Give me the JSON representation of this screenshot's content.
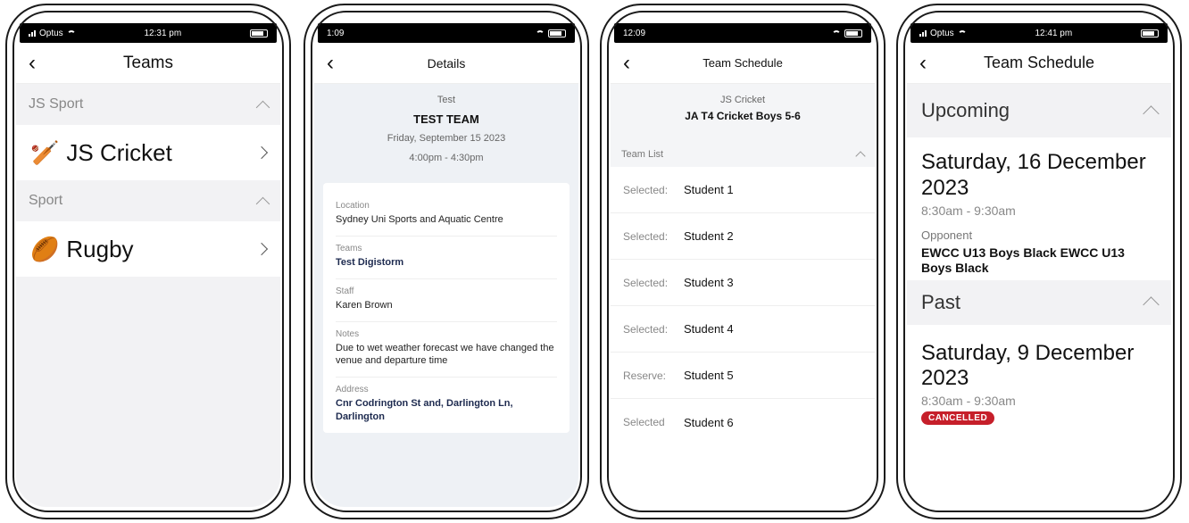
{
  "phone1": {
    "status": {
      "carrier": "Optus",
      "time": "12:31 pm"
    },
    "title": "Teams",
    "sections": [
      {
        "name": "JS Sport",
        "item": "JS Cricket"
      },
      {
        "name": "Sport",
        "item": "Rugby"
      }
    ]
  },
  "phone2": {
    "status": {
      "time": "1:09"
    },
    "title": "Details",
    "header": {
      "subtitle": "Test",
      "team": "TEST TEAM",
      "date": "Friday, September 15 2023",
      "time": "4:00pm - 4:30pm"
    },
    "fields": {
      "location_label": "Location",
      "location": "Sydney Uni Sports and Aquatic Centre",
      "teams_label": "Teams",
      "teams": "Test Digistorm",
      "staff_label": "Staff",
      "staff": "Karen Brown",
      "notes_label": "Notes",
      "notes": "Due to wet weather forecast we have changed the venue and departure time",
      "address_label": "Address",
      "address": "Cnr Codrington St and, Darlington Ln, Darlington"
    }
  },
  "phone3": {
    "status": {
      "time": "12:09"
    },
    "title": "Team Schedule",
    "header": {
      "subtitle": "JS Cricket",
      "team": "JA T4 Cricket Boys 5-6"
    },
    "list_label": "Team List",
    "students": [
      {
        "status": "Selected:",
        "name": "Student 1"
      },
      {
        "status": "Selected:",
        "name": "Student 2"
      },
      {
        "status": "Selected:",
        "name": "Student 3"
      },
      {
        "status": "Selected:",
        "name": "Student 4"
      },
      {
        "status": "Reserve:",
        "name": "Student 5"
      },
      {
        "status": "Selected",
        "name": "Student 6"
      }
    ]
  },
  "phone4": {
    "status": {
      "carrier": "Optus",
      "time": "12:41 pm"
    },
    "title": "Team Schedule",
    "upcoming_label": "Upcoming",
    "upcoming": {
      "date": "Saturday, 16 December 2023",
      "time": "8:30am - 9:30am",
      "opponent_label": "Opponent",
      "opponent": "EWCC U13 Boys Black EWCC U13 Boys Black"
    },
    "past_label": "Past",
    "past": {
      "date": "Saturday, 9 December 2023",
      "time": "8:30am - 9:30am",
      "badge": "CANCELLED"
    }
  },
  "colors": {
    "badge": "#c61f2a",
    "section_bg": "#f2f2f4",
    "accent_text": "#1d2a4f"
  }
}
